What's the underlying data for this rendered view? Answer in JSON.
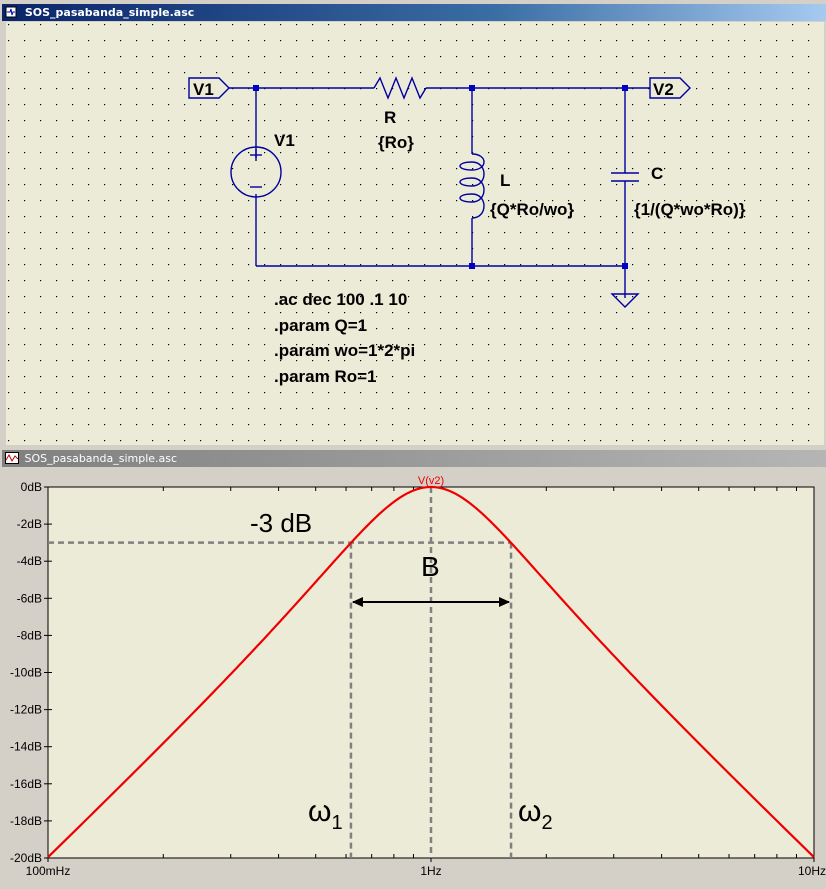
{
  "schematic_window": {
    "title": "SOS_pasabanda_simple.asc",
    "ports": {
      "in_label": "V1",
      "out_label": "V2"
    },
    "components": {
      "source": {
        "name": "V1"
      },
      "resistor": {
        "name": "R",
        "value": "{Ro}"
      },
      "inductor": {
        "name": "L",
        "value": "{Q*Ro/wo}"
      },
      "capacitor": {
        "name": "C",
        "value": "{1/(Q*wo*Ro)}"
      }
    },
    "directives": [
      ".ac dec 100 .1 10",
      ".param Q=1",
      ".param wo=1*2*pi",
      ".param Ro=1"
    ]
  },
  "plot_window": {
    "title": "SOS_pasabanda_simple.asc",
    "annotations": {
      "minus3db": "-3 dB",
      "bandwidth": "B",
      "w1": "ω",
      "w1_sub": "1",
      "w2": "ω",
      "w2_sub": "2"
    }
  },
  "chart_data": {
    "type": "line",
    "title": "",
    "xlabel": "",
    "ylabel": "",
    "x_scale": "log",
    "xlim": [
      0.1,
      10
    ],
    "ylim": [
      -20,
      0
    ],
    "x_tick_labels": [
      "100mHz",
      "1Hz",
      "10Hz"
    ],
    "y_tick_labels": [
      "0dB",
      "-2dB",
      "-4dB",
      "-6dB",
      "-8dB",
      "-10dB",
      "-12dB",
      "-14dB",
      "-16dB",
      "-18dB",
      "-20dB"
    ],
    "grid": false,
    "series": [
      {
        "name": "V(v2)",
        "color": "#ff0000",
        "x": [
          0.1,
          0.2,
          0.4,
          0.618,
          1.0,
          1.618,
          2.5,
          5.0,
          10.0
        ],
        "y": [
          -20.0,
          -13.8,
          -7.9,
          -3.0,
          0.0,
          -3.0,
          -6.5,
          -13.8,
          -20.0
        ]
      }
    ],
    "reference_lines": {
      "level_db": -3,
      "f1": 0.618,
      "f2": 1.618,
      "f0": 1.0
    }
  }
}
